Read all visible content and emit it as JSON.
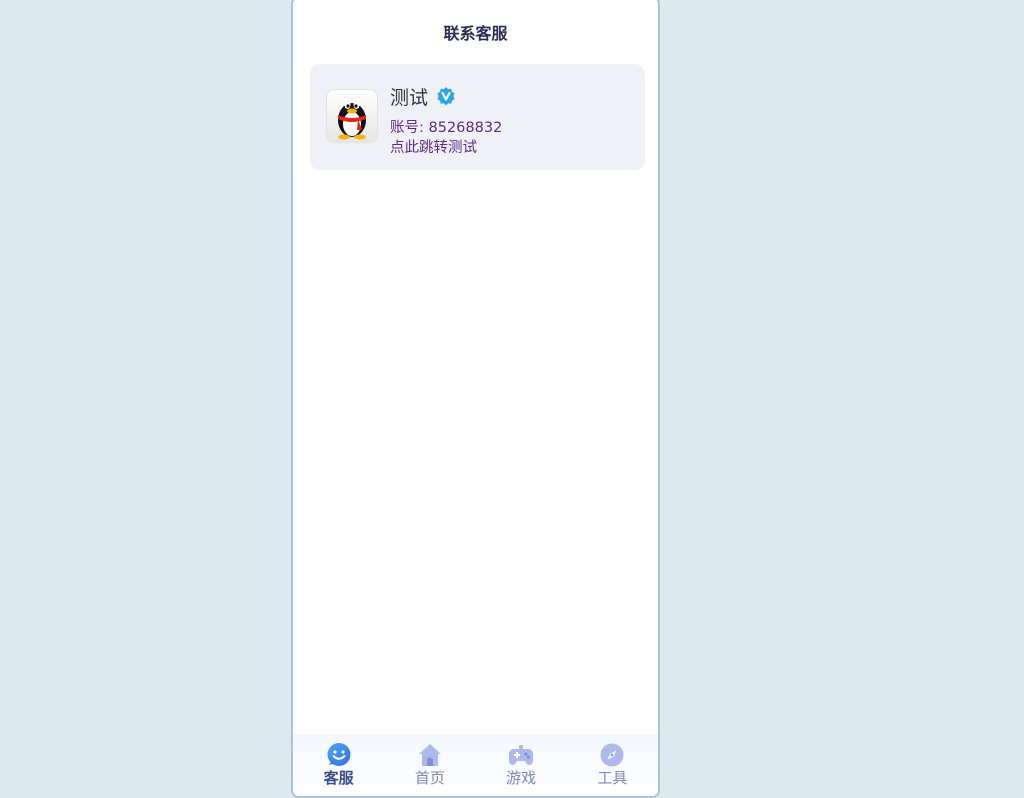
{
  "header": {
    "title": "联系客服"
  },
  "contact": {
    "name": "测试",
    "account_text": "账号: 85268832",
    "link_text": "点此跳转测试",
    "avatar_icon": "qq-penguin-icon",
    "badge_icon": "verified-v-icon"
  },
  "tabbar": {
    "items": [
      {
        "label": "客服",
        "icon": "chat-smile-icon",
        "active": true
      },
      {
        "label": "首页",
        "icon": "home-icon",
        "active": false
      },
      {
        "label": "游戏",
        "icon": "gamepad-icon",
        "active": false
      },
      {
        "label": "工具",
        "icon": "compass-icon",
        "active": false
      }
    ]
  },
  "colors": {
    "background": "#dde9f1",
    "card": "#f0f1f7",
    "accent_text": "#5b2d86",
    "title": "#2b2d55",
    "tab_active": "#3f4a8a",
    "tab_inactive": "#7c87b4"
  }
}
